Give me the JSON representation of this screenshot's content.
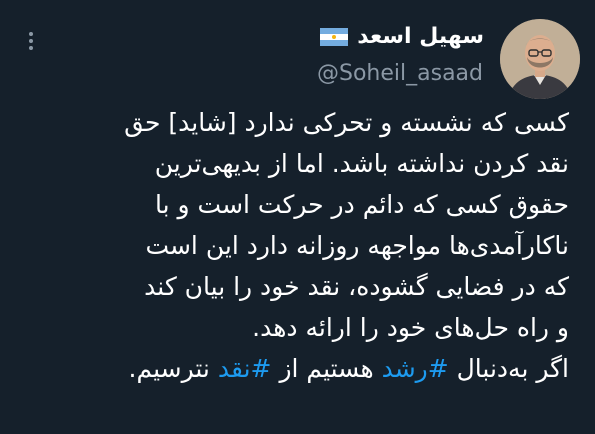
{
  "header": {
    "display_name": "سهیل اسعد",
    "flag_icon": "argentina-flag-icon",
    "handle": "@Soheil_asaad",
    "more_icon": "more-options-icon"
  },
  "tweet": {
    "lines": [
      "کسی که نشسته و تحرکی ندارد [شاید] حق",
      "نقد کردن نداشته باشد. اما از بدیهی‌ترین",
      "حقوق کسی که دائم در حرکت است و با",
      "ناکارآمدی‌ها مواجهه روزانه دارد این است",
      "که در فضایی گشوده، نقد خود را بیان کند",
      "و راه حل‌های خود را ارائه دهد."
    ],
    "last_line": {
      "before": "اگر به‌دنبال ",
      "hashtag1": "#رشد",
      "middle": " هستیم از ",
      "hashtag2": "#نقد",
      "after": " نترسیم."
    }
  },
  "colors": {
    "background": "#15202b",
    "text": "#ffffff",
    "secondary_text": "#8b98a5",
    "hashtag": "#1d9bf0"
  }
}
